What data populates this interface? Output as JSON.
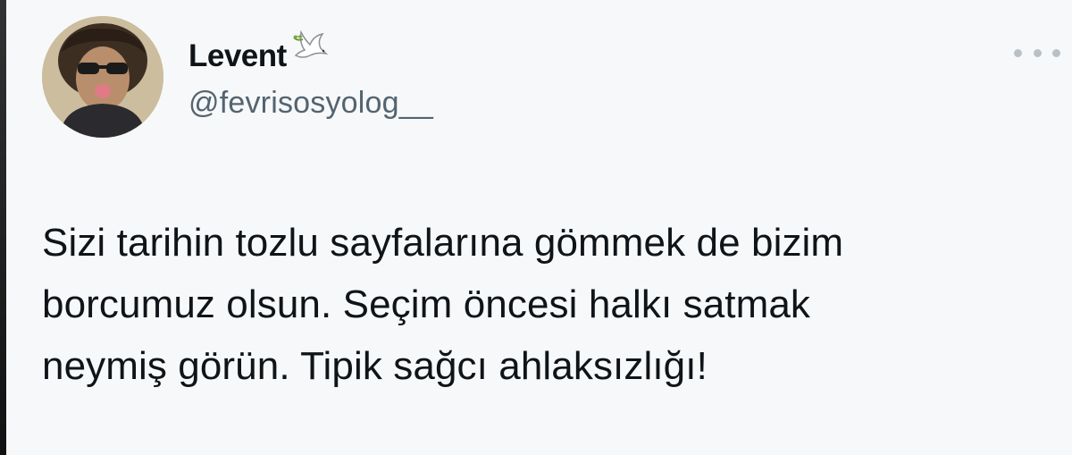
{
  "tweet": {
    "author": {
      "display_name": "Levent",
      "handle": "@fevrisosyolog__",
      "badge_icon": "dove-with-olive-branch-icon",
      "avatar_icon": "profile-photo-avatar"
    },
    "more_icon": "more-options-icon",
    "text_lines": [
      "Sizi tarihin tozlu sayfalarına gömmek de bizim",
      "borcumuz olsun. Seçim öncesi halkı satmak",
      "neymiş görün. Tipik sağcı ahlaksızlığı!"
    ],
    "colors": {
      "background": "#f7f8f9",
      "text": "#0f1419",
      "secondary_text": "#536471"
    }
  }
}
